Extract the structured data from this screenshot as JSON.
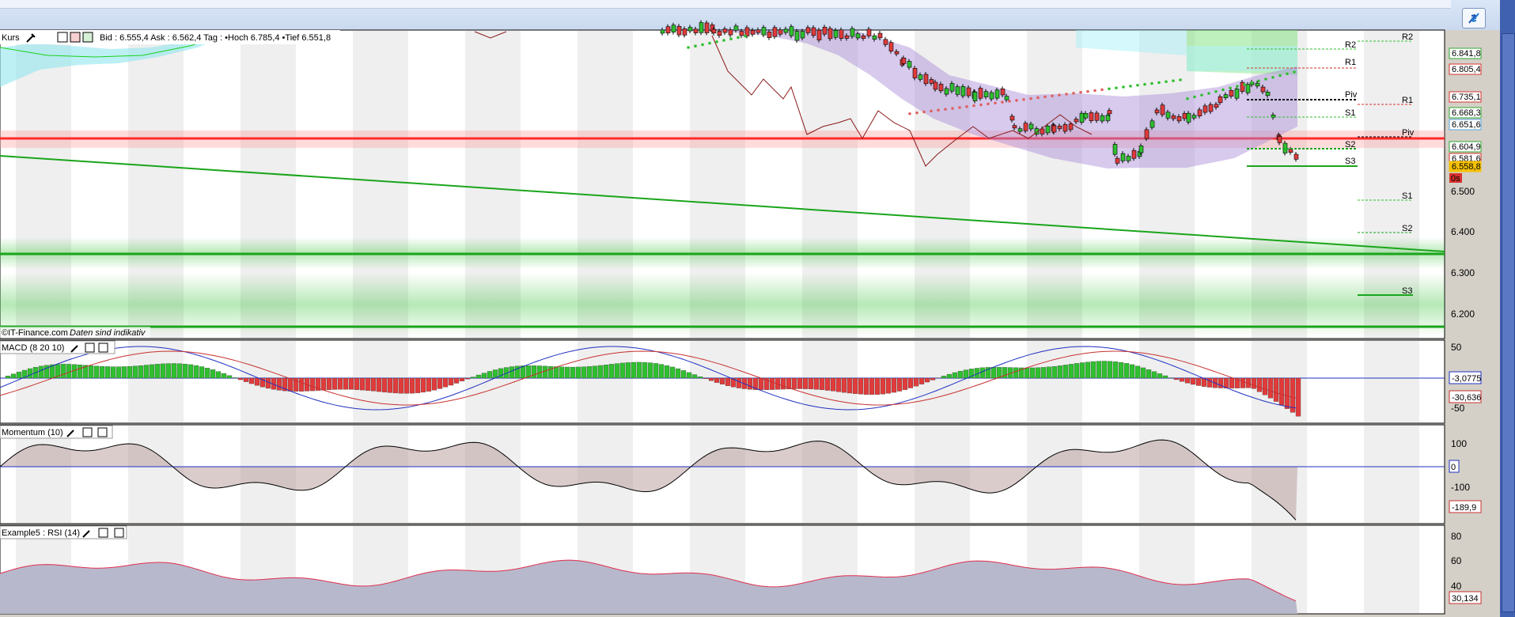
{
  "main": {
    "title": "Kurs",
    "quote": "Bid : 6.555,4 Ask : 6.562,4  Tag : •Hoch 6.785,4 •Tief 6.551,8",
    "source": "©IT-Finance.com",
    "disclaimer": "Daten sind indikativ",
    "axis_labels": [
      "6.500",
      "6.400",
      "6.300",
      "6.200"
    ],
    "price_tags": [
      {
        "text": "6.841,8",
        "color": "#2fa82f"
      },
      {
        "text": "6.805,4",
        "color": "#d8322d"
      },
      {
        "text": "6.735,1",
        "color": "#d8322d"
      },
      {
        "text": "6.668,3",
        "color": "#2fa82f"
      },
      {
        "text": "6.651,6",
        "color": "#5aa6e0"
      },
      {
        "text": "6.604,9",
        "color": "#2fa82f"
      },
      {
        "text": "6.581,6",
        "color": "#d8322d"
      },
      {
        "text": "6.558,8",
        "color": "#f4c000"
      }
    ],
    "price_tag_suffix": "0s",
    "pivots_near": [
      "R2",
      "R1",
      "Piv",
      "S1",
      "S2",
      "S3"
    ],
    "pivots_far": [
      "R2",
      "R1",
      "Piv",
      "S1",
      "S2",
      "S3"
    ]
  },
  "macd": {
    "title": "MACD (8 20 10)",
    "axis": [
      "50",
      "-50"
    ],
    "tags": [
      "-3,0775",
      "-30,636"
    ]
  },
  "momentum": {
    "title": "Momentum (10)",
    "axis": [
      "100",
      "0",
      "-100"
    ],
    "tags": [
      "0",
      "-189,9"
    ]
  },
  "rsi": {
    "title": "Example5 : RSI (14)",
    "axis": [
      "80",
      "60",
      "40"
    ],
    "tags": [
      "30,134"
    ]
  },
  "colors": {
    "bull": "#2fbf2f",
    "bear": "#e03b3b",
    "cloud": "#a78ad8",
    "kumo_bull": "#7be27b",
    "kumo_bear": "#e6a6a6",
    "support": "#1aa51a"
  }
}
